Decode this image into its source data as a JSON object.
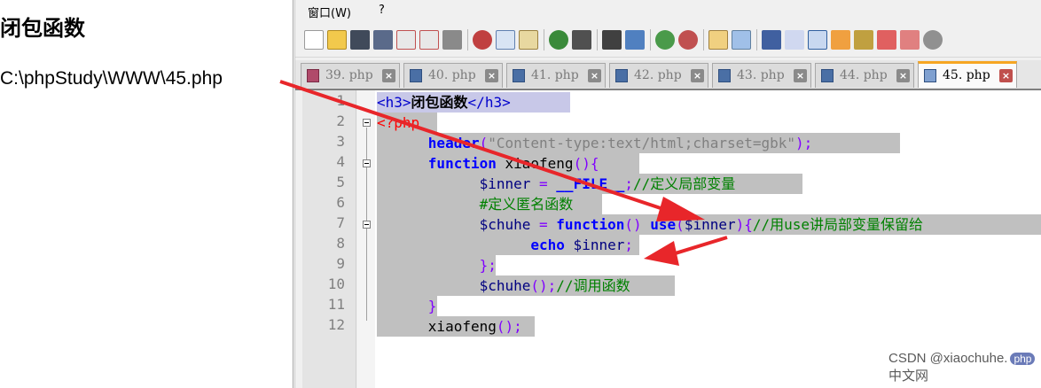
{
  "output": {
    "title": "闭包函数",
    "path": "C:\\phpStudy\\WWW\\45.php"
  },
  "editor": {
    "menu": [
      "窗口(W)",
      "?"
    ],
    "tabs": [
      "39. php",
      "40. php",
      "41. php",
      "42. php",
      "43. php",
      "44. php",
      "45. php"
    ],
    "active_tab": "45. php",
    "line_numbers": [
      "1",
      "2",
      "3",
      "4",
      "5",
      "6",
      "7",
      "8",
      "9",
      "10",
      "11",
      "12"
    ],
    "code": {
      "l1_open": "<h3>",
      "l1_text": "闭包函数",
      "l1_close": "</h3>",
      "l2": "<?php",
      "l3_fn": "header",
      "l3_p1": "(",
      "l3_str": "\"Content-type:text/html;charset=gbk\"",
      "l3_p2": ");",
      "l4_kw": "function",
      "l4_name": " xiaofeng",
      "l4_p": "(){",
      "l5_var": "$inner",
      "l5_op": " = ",
      "l5_const": "__FILE__",
      "l5_p": ";",
      "l5_cm": "//定义局部变量",
      "l6_cm": "#定义匿名函数",
      "l7_var": "$chuhe",
      "l7_op": " = ",
      "l7_kw": "function",
      "l7_p1": "() ",
      "l7_use": "use",
      "l7_p2": "(",
      "l7_var2": "$inner",
      "l7_p3": "){",
      "l7_cm": "//用use讲局部变量保留给",
      "l8_kw": "echo",
      "l8_var": " $inner",
      "l8_p": ";",
      "l9": "};",
      "l10_var": "$chuhe",
      "l10_p": "();",
      "l10_cm": "//调用函数",
      "l11": "}",
      "l12_name": "xiaofeng",
      "l12_p": "();"
    }
  },
  "watermark": {
    "prefix": "CSDN @xiaochuhe.",
    "badge": "php",
    "site": "中文网"
  },
  "colors": {
    "selection": "#c0c0c0",
    "keyword": "#0000ff",
    "comment": "#008000",
    "arrow": "#e8262a",
    "active_tab_accent": "#f6a623"
  }
}
